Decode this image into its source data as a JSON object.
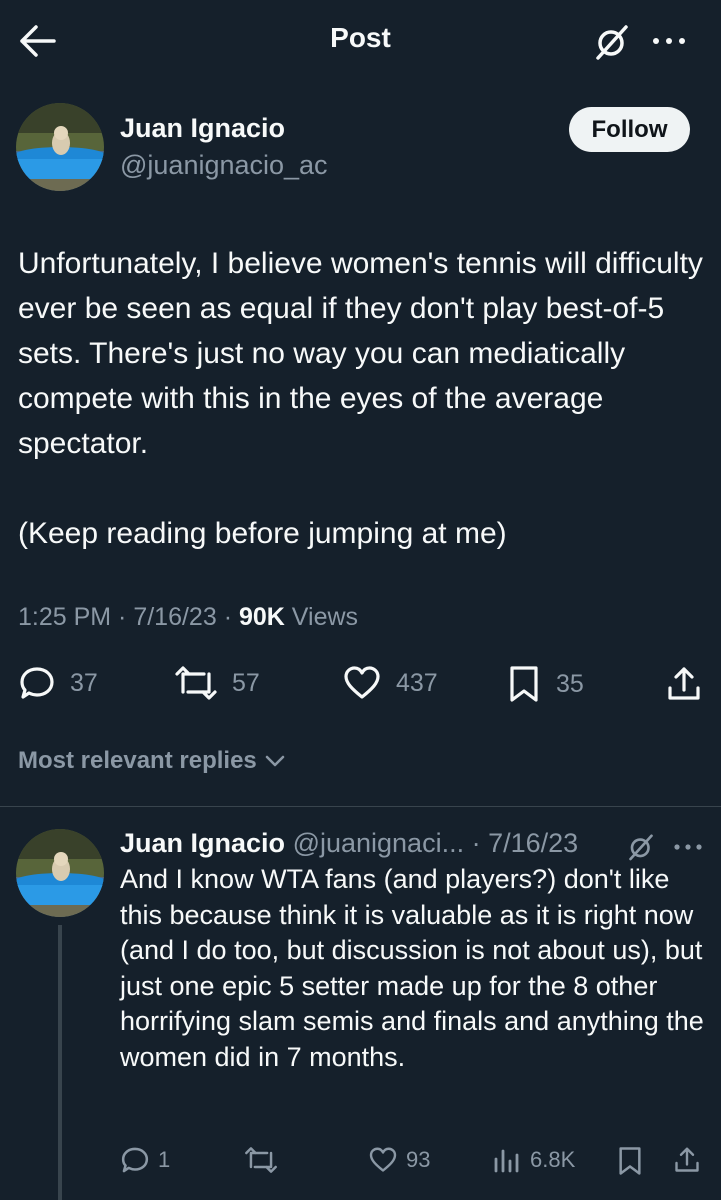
{
  "header": {
    "title": "Post"
  },
  "post": {
    "author_name": "Juan Ignacio",
    "author_handle": "@juanignacio_ac",
    "follow_label": "Follow",
    "text_paragraph_1": "Unfortunately, I believe women's tennis will difficulty ever be seen as equal if they don't play best-of-5 sets. There's just no way you can mediatically compete with this in the eyes of the average spectator.",
    "text_paragraph_2": "(Keep reading before jumping at me)",
    "time": "1:25 PM",
    "date": "7/16/23",
    "views_count": "90K",
    "views_label": "Views",
    "replies": "37",
    "reposts": "57",
    "likes": "437",
    "bookmarks": "35"
  },
  "replies_sort": {
    "label": "Most relevant replies"
  },
  "reply": {
    "author_name": "Juan Ignacio",
    "author_handle": "@juanignaci...",
    "date": "7/16/23",
    "text": "And I know WTA fans (and players?) don't like this because think it is valuable as it is right now (and I do too, but discussion is not about us), but just one epic 5 setter made up for the 8 other horrifying slam semis and finals and anything the women did in 7 months.",
    "replies": "1",
    "likes": "93",
    "views": "6.8K"
  },
  "colors": {
    "background": "#15202b",
    "text": "#f7f9f9",
    "secondary": "#8b98a5",
    "divider": "#38444d"
  }
}
